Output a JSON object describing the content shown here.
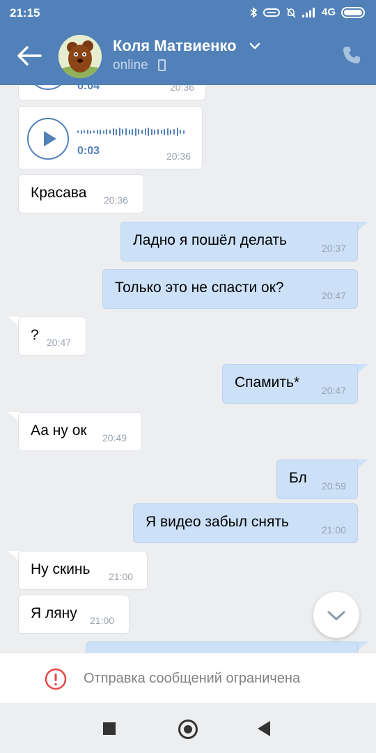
{
  "status_bar": {
    "time": "21:15",
    "network": "4G",
    "icons": [
      "bluetooth-icon",
      "link-icon",
      "mute-bell-icon",
      "signal-icon",
      "battery-icon"
    ]
  },
  "header": {
    "contact_name": "Коля Матвиенко",
    "status": "online",
    "icons": [
      "back-arrow-icon",
      "chevron-down-icon",
      "mobile-icon",
      "phone-icon"
    ],
    "colors": {
      "header_bg": "#5181b8",
      "status_text": "#c5d5ea"
    }
  },
  "messages": [
    {
      "dir": "in",
      "type": "voice",
      "duration": "0:04",
      "time": "20:36",
      "partially_visible": true
    },
    {
      "dir": "in",
      "type": "voice",
      "duration": "0:03",
      "time": "20:36"
    },
    {
      "dir": "in",
      "type": "text",
      "text": "Красава",
      "time": "20:36"
    },
    {
      "dir": "out",
      "type": "text",
      "text": "Ладно я пошёл делать",
      "time": "20:37"
    },
    {
      "dir": "out",
      "type": "text",
      "text": "Только это не спасти ок?",
      "time": "20:47"
    },
    {
      "dir": "in",
      "type": "text",
      "text": "?",
      "time": "20:47"
    },
    {
      "dir": "out",
      "type": "text",
      "text": "Спамить*",
      "time": "20:47"
    },
    {
      "dir": "in",
      "type": "text",
      "text": "Аа ну ок",
      "time": "20:49"
    },
    {
      "dir": "out",
      "type": "text",
      "text": "Бл",
      "time": "20:59"
    },
    {
      "dir": "out",
      "type": "text",
      "text": "Я видео забыл снять",
      "time": "21:00"
    },
    {
      "dir": "in",
      "type": "text",
      "text": "Ну скинь",
      "time": "21:00"
    },
    {
      "dir": "in",
      "type": "text",
      "text": "Я ляну",
      "time": "21:00"
    }
  ],
  "notice": {
    "text": "Отправка сообщений ограничена",
    "icon": "warning-circle-icon",
    "color": "#e64646"
  },
  "colors": {
    "in_bubble": "#ffffff",
    "out_bubble": "#cce0f8",
    "chat_bg": "#edeef0",
    "accent": "#5181b8"
  }
}
